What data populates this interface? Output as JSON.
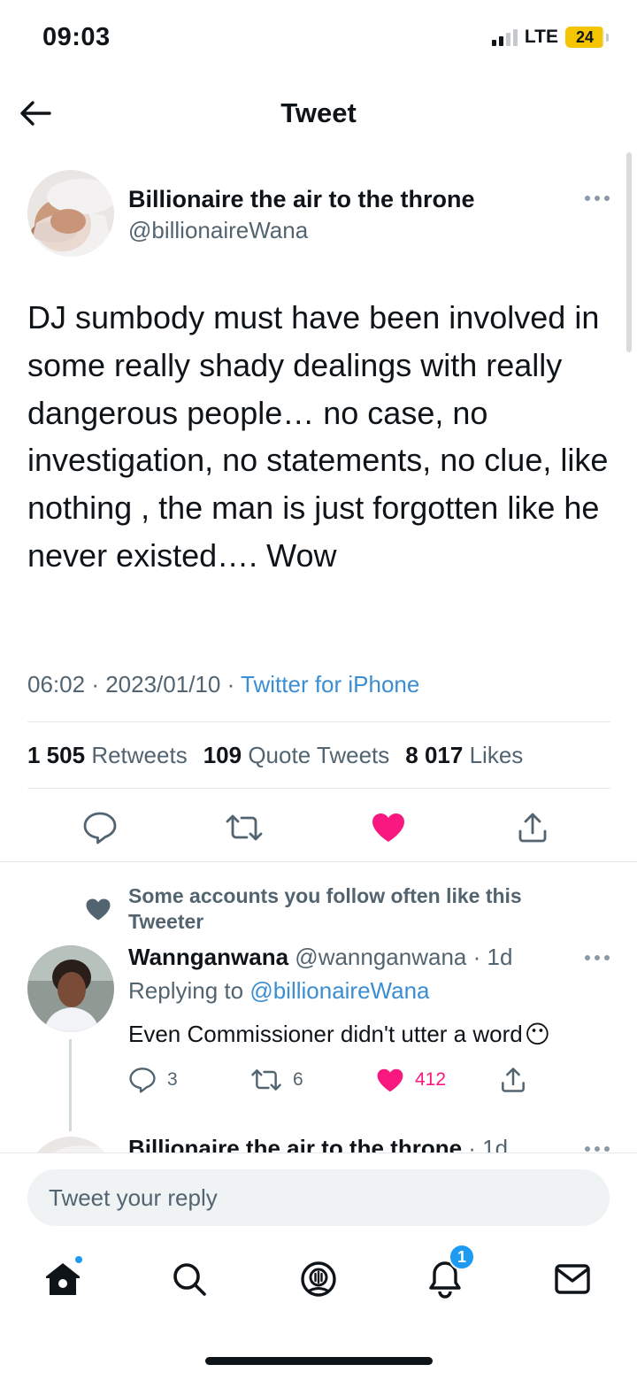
{
  "status_bar": {
    "time": "09:03",
    "network": "LTE",
    "battery_level": "24",
    "battery_fraction": 0.24,
    "battery_color": "#f5c400"
  },
  "header": {
    "title": "Tweet",
    "back_icon": "arrow-left-icon"
  },
  "tweet": {
    "author_name": "Billionaire the air to the throne",
    "author_handle": "@billionaireWana",
    "text": "DJ sumbody must have been involved in some really shady dealings with really dangerous people… no case, no investigation, no statements, no clue, like nothing , the man is just forgotten like he never existed…. Wow",
    "time": "06:02",
    "date": "2023/01/10",
    "separator": "·",
    "source": "Twitter for iPhone",
    "stats": {
      "retweets_count": "1 505",
      "retweets_label": "Retweets",
      "quotes_count": "109",
      "quotes_label": "Quote Tweets",
      "likes_count": "8 017",
      "likes_label": "Likes"
    },
    "liked": true,
    "like_color": "#f91880"
  },
  "reply": {
    "social_context": "Some accounts you follow often like this Tweeter",
    "author_name": "Wannganwana",
    "author_handle": "@wannganwana",
    "age": "· 1d",
    "replying_to_label": "Replying to",
    "replying_to_handle": "@billionaireWana",
    "text": "Even Commissioner didn't utter a word",
    "emoji": "😶",
    "replies": "3",
    "retweets": "6",
    "likes": "412"
  },
  "next_reply": {
    "author_name": "Billionaire the air to the throne",
    "age": "· 1d"
  },
  "composer": {
    "placeholder": "Tweet your reply"
  },
  "tabbar": {
    "notifications_badge": "1",
    "items": [
      "home-icon",
      "search-icon",
      "spaces-icon",
      "notifications-icon",
      "messages-icon"
    ]
  },
  "colors": {
    "accent": "#1d9bf0",
    "text": "#0f1419",
    "secondary": "#536471",
    "like": "#f91880"
  }
}
